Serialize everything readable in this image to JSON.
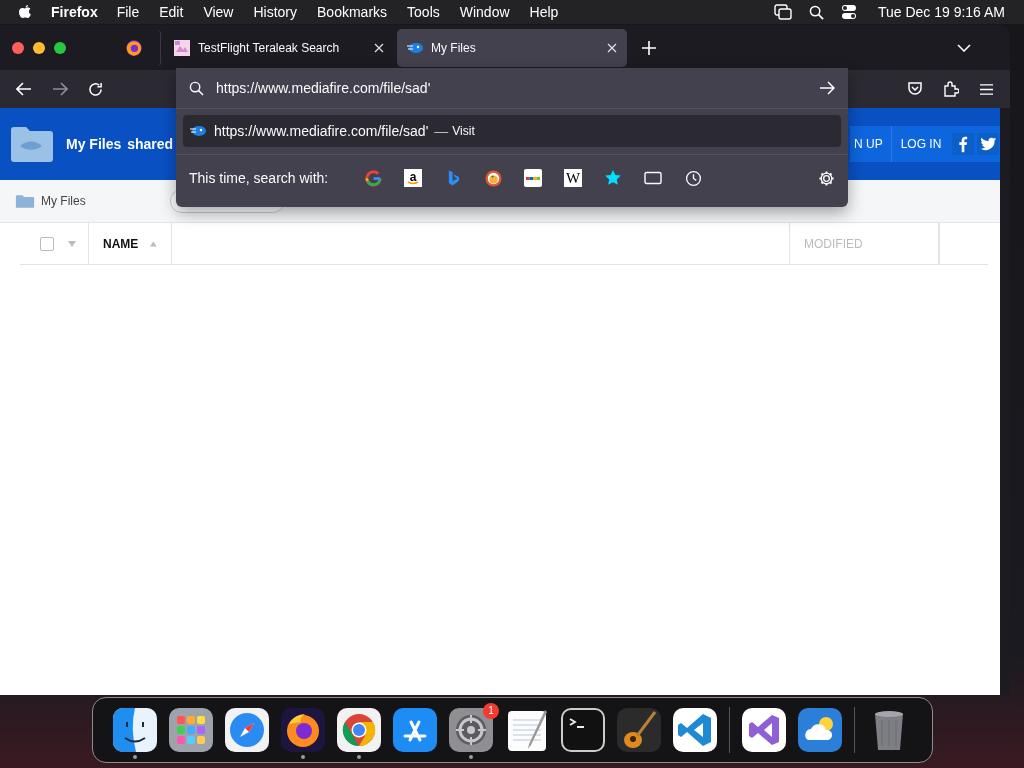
{
  "menu_bar": {
    "app": "Firefox",
    "items": [
      "File",
      "Edit",
      "View",
      "History",
      "Bookmarks",
      "Tools",
      "Window",
      "Help"
    ],
    "clock": "Tue Dec 19  9:16 AM"
  },
  "tabs": [
    {
      "kind": "pinned",
      "selected": false
    },
    {
      "kind": "tab",
      "title": "TestFlight Teraleak Search",
      "selected": false
    },
    {
      "kind": "tab",
      "title": "My Files",
      "selected": true
    }
  ],
  "address_bar": {
    "value": "https://www.mediafire.com/file/sad'"
  },
  "suggestions": [
    {
      "url": "https://www.mediafire.com/file/sad'",
      "separator": "—",
      "action": "Visit",
      "selected": true
    }
  ],
  "search_with": {
    "label": "This time, search with:",
    "engines": [
      {
        "kind": "google"
      },
      {
        "kind": "amazon",
        "glyph": "a"
      },
      {
        "kind": "bing"
      },
      {
        "kind": "duck"
      },
      {
        "kind": "ebay"
      },
      {
        "kind": "wiki",
        "glyph": "W"
      },
      {
        "kind": "bookmarks"
      },
      {
        "kind": "tabs"
      },
      {
        "kind": "history"
      }
    ]
  },
  "page": {
    "header_links": [
      "My Files",
      "shared"
    ],
    "header_buttons": [
      "N UP",
      "LOG IN"
    ],
    "breadcrumb": "My Files",
    "table": {
      "select_all": {
        "checked": false
      },
      "columns": [
        {
          "label": "NAME",
          "sorted": true
        },
        {
          "label": "MODIFIED",
          "sorted": false
        }
      ]
    }
  },
  "dock": [
    {
      "kind": "finder",
      "running": true
    },
    {
      "kind": "launchpad",
      "running": false
    },
    {
      "kind": "safari",
      "running": false
    },
    {
      "kind": "firefox",
      "running": true
    },
    {
      "kind": "chrome",
      "running": true
    },
    {
      "kind": "appstore",
      "running": false
    },
    {
      "kind": "settings",
      "running": true,
      "badge": "1"
    },
    {
      "kind": "textedit",
      "running": false
    },
    {
      "kind": "terminal",
      "running": false
    },
    {
      "kind": "garageband",
      "running": false
    },
    {
      "kind": "vscode",
      "running": false
    },
    {
      "kind": "divider"
    },
    {
      "kind": "vs",
      "running": false
    },
    {
      "kind": "weather",
      "running": false
    },
    {
      "kind": "divider"
    },
    {
      "kind": "trash",
      "running": false
    }
  ]
}
